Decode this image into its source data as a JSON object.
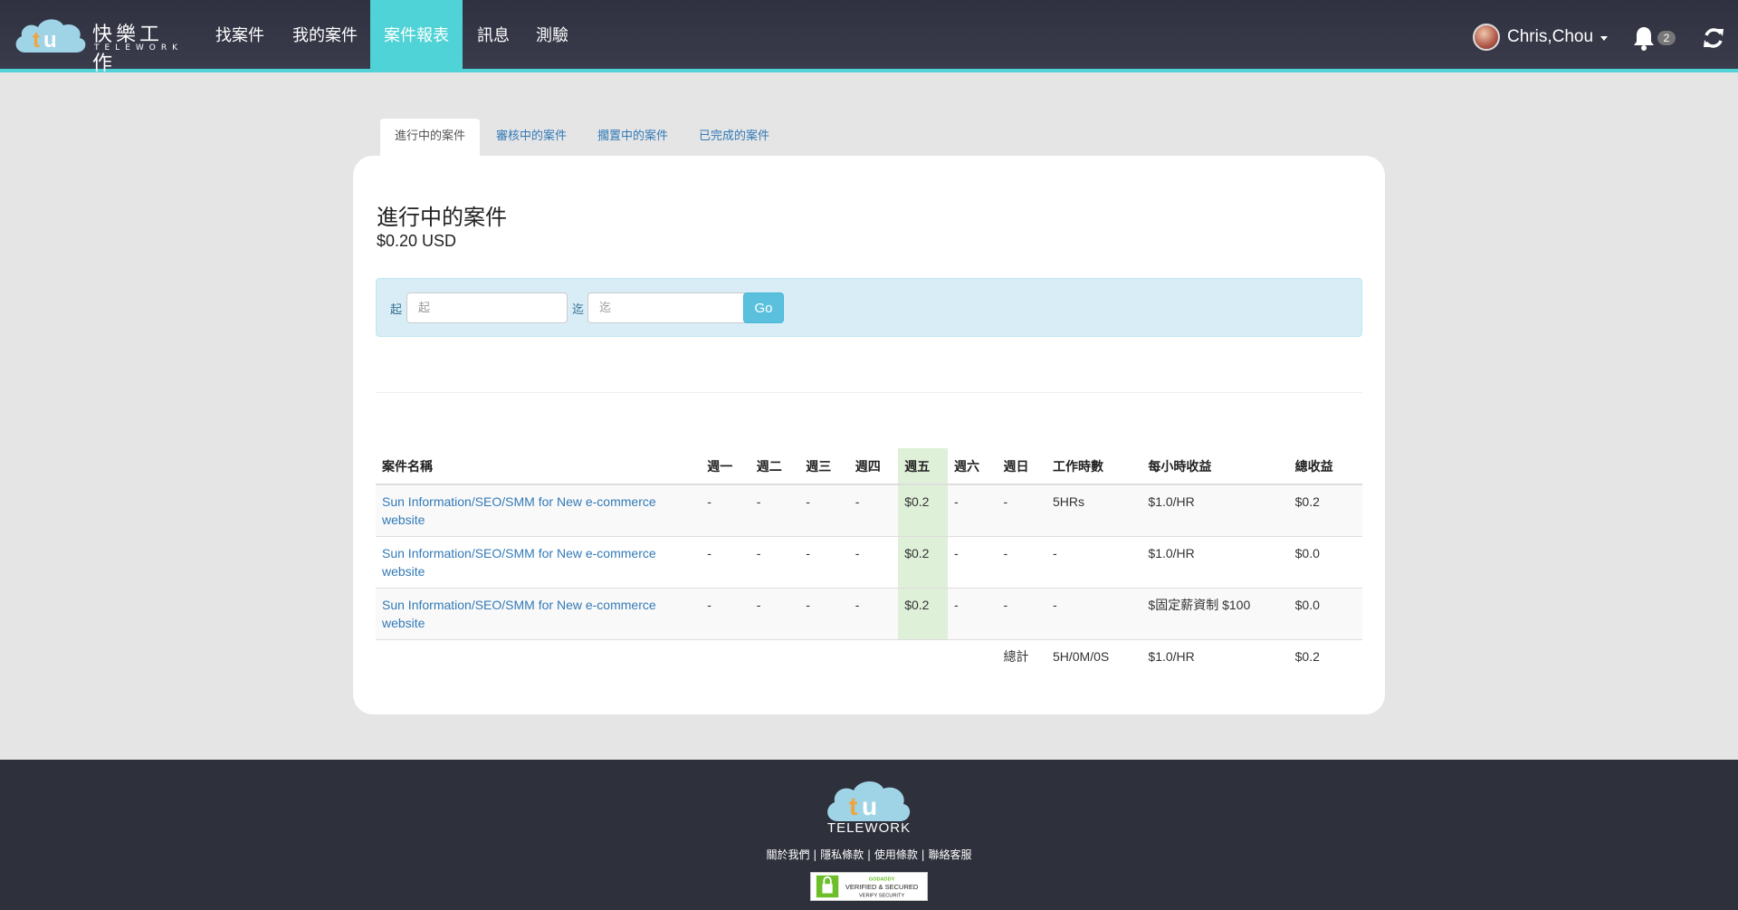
{
  "nav": {
    "logo_zh": "快樂工作",
    "logo_en": "TELEWORK",
    "items": [
      "找案件",
      "我的案件",
      "案件報表",
      "訊息",
      "測驗"
    ],
    "active_index": 2,
    "user_name": "Chris,Chou",
    "notification_count": "2"
  },
  "tabs": [
    "進行中的案件",
    "審核中的案件",
    "擱置中的案件",
    "已完成的案件"
  ],
  "panel": {
    "title": "進行中的案件",
    "amount": "$0.20 USD"
  },
  "filter": {
    "from_label": "起",
    "from_placeholder": "起",
    "to_label": "迄",
    "to_placeholder": "迄",
    "go_label": "Go"
  },
  "table": {
    "headers": [
      "案件名稱",
      "週一",
      "週二",
      "週三",
      "週四",
      "週五",
      "週六",
      "週日",
      "工作時數",
      "每小時收益",
      "總收益"
    ],
    "rows": [
      {
        "name": "Sun Information/SEO/SMM for New e-commerce website",
        "mon": "-",
        "tue": "-",
        "wed": "-",
        "thu": "-",
        "fri": "$0.2",
        "sat": "-",
        "sun": "-",
        "hours": "5HRs",
        "rate": "$1.0/HR",
        "total": "$0.2"
      },
      {
        "name": "Sun Information/SEO/SMM for New e-commerce website",
        "mon": "-",
        "tue": "-",
        "wed": "-",
        "thu": "-",
        "fri": "$0.2",
        "sat": "-",
        "sun": "-",
        "hours": "-",
        "rate": "$1.0/HR",
        "total": "$0.0"
      },
      {
        "name": "Sun Information/SEO/SMM for New e-commerce website",
        "mon": "-",
        "tue": "-",
        "wed": "-",
        "thu": "-",
        "fri": "$0.2",
        "sat": "-",
        "sun": "-",
        "hours": "-",
        "rate": "$固定薪資制 $100",
        "total": "$0.0"
      }
    ],
    "summary": {
      "label": "總計",
      "hours": "5H/0M/0S",
      "rate": "$1.0/HR",
      "total": "$0.2"
    }
  },
  "footer": {
    "logo_text": "TELEWORK",
    "links": [
      "關於我們",
      "隱私條款",
      "使用條款",
      "聯絡客服"
    ],
    "seal_brand": "GODADDY",
    "seal_line1": "VERIFIED & SECURED",
    "seal_line2": "VERIFY SECURITY"
  },
  "colors": {
    "navbar": "#2f3140",
    "accent": "#4fd3d6",
    "filter_bg": "#d9edf7",
    "friday_highlight": "#dff0d8",
    "link": "#337ab7"
  }
}
